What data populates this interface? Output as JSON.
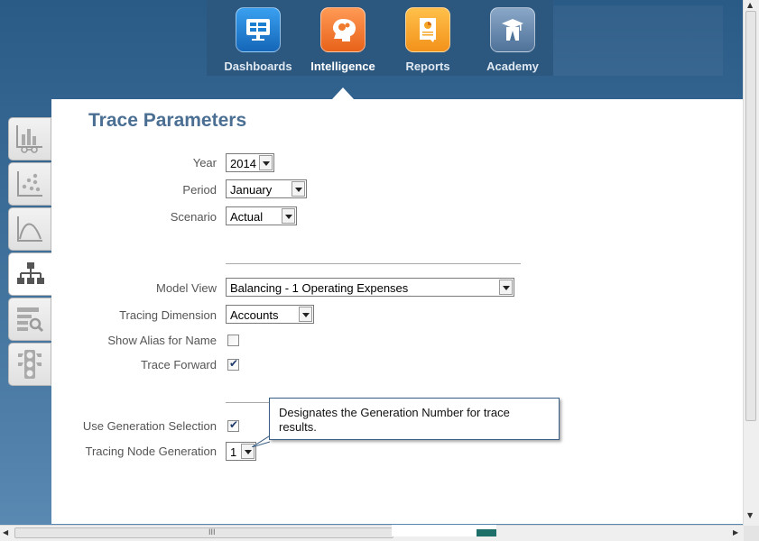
{
  "nav": {
    "items": [
      {
        "label": "Dashboards",
        "icon": "dashboards-icon",
        "color": "#1b7fd1"
      },
      {
        "label": "Intelligence",
        "icon": "intelligence-icon",
        "color": "#f07a2e"
      },
      {
        "label": "Reports",
        "icon": "reports-icon",
        "color": "#f5a623"
      },
      {
        "label": "Academy",
        "icon": "academy-icon",
        "color": "#5a7fa8"
      }
    ],
    "active": "Intelligence"
  },
  "panel": {
    "title": "Trace Parameters",
    "fields": {
      "year": {
        "label": "Year",
        "value": "2014"
      },
      "period": {
        "label": "Period",
        "value": "January"
      },
      "scenario": {
        "label": "Scenario",
        "value": "Actual"
      },
      "model_view": {
        "label": "Model View",
        "value": "Balancing - 1 Operating Expenses"
      },
      "tracing_dimension": {
        "label": "Tracing Dimension",
        "value": "Accounts"
      },
      "show_alias": {
        "label": "Show Alias for Name",
        "checked": false
      },
      "trace_forward": {
        "label": "Trace Forward",
        "checked": true
      },
      "use_generation": {
        "label": "Use Generation Selection",
        "checked": true
      },
      "node_generation": {
        "label": "Tracing Node Generation",
        "value": "1"
      }
    },
    "tooltip": "Designates the Generation Number for trace results."
  },
  "left_tabs": [
    {
      "name": "tab-bar-chart-icon",
      "active": false
    },
    {
      "name": "tab-scatter-chart-icon",
      "active": false
    },
    {
      "name": "tab-curve-chart-icon",
      "active": false
    },
    {
      "name": "tab-hierarchy-icon",
      "active": true
    },
    {
      "name": "tab-report-search-icon",
      "active": false
    },
    {
      "name": "tab-traffic-light-icon",
      "active": false
    }
  ],
  "scrollbar": {
    "grip": "III"
  },
  "colors": {
    "accent": "#4b6f93",
    "background": "#2f628f",
    "panel": "#ffffff"
  }
}
